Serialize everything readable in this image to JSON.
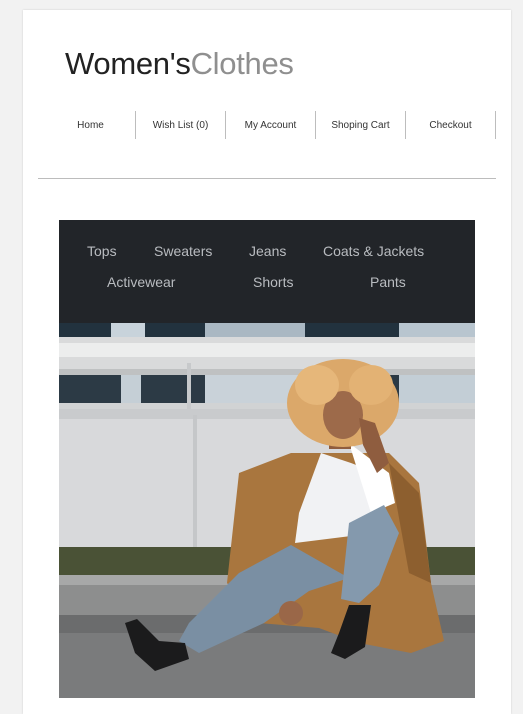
{
  "logo": {
    "part1": "Women's",
    "part2": "Clothes"
  },
  "topnav": [
    {
      "label": "Home"
    },
    {
      "label": "Wish List (0)"
    },
    {
      "label": "My Account"
    },
    {
      "label": "Shoping Cart"
    },
    {
      "label": "Checkout"
    }
  ],
  "categories": {
    "row1": [
      "Tops",
      "Sweaters",
      "Jeans",
      "Coats & Jackets"
    ],
    "row2": [
      "Activewear",
      "Shorts",
      "Pants"
    ]
  },
  "colors": {
    "logo_dark": "#222222",
    "logo_light": "#8f8f8f",
    "category_bar": "#222529",
    "category_text": "#b9bcc0"
  }
}
